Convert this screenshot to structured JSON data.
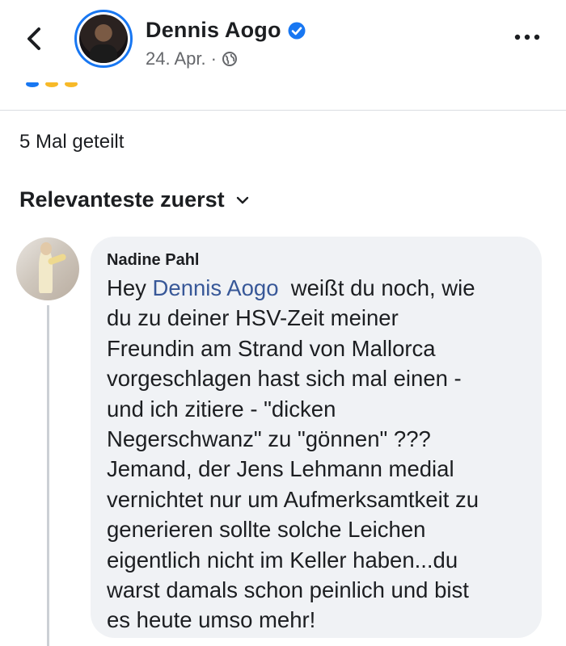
{
  "header": {
    "author_name": "Dennis Aogo",
    "date": "24. Apr.",
    "separator": "·",
    "icons": {
      "back": "chevron-left-icon",
      "verified": "verified-badge-icon",
      "audience": "globe-icon",
      "more": "more-dots-icon"
    },
    "colors": {
      "verified": "#1877f2",
      "avatar_ring": "#1877f2"
    }
  },
  "post_stats": {
    "shares": "5 Mal geteilt"
  },
  "comments_sort": {
    "label": "Relevanteste zuerst",
    "icon": "chevron-down-icon"
  },
  "comment": {
    "author": "Nadine Pahl",
    "prefix": "Hey ",
    "mention": "Dennis Aogo",
    "body": "  weißt du noch, wie\ndu zu deiner HSV-Zeit meiner\nFreundin am Strand von Mallorca\nvorgeschlagen hast sich mal einen -\nund ich zitiere - \"dicken\nNegerschwanz\" zu \"gönnen\" ???\nJemand, der Jens Lehmann medial\nvernichtet nur um Aufmerksamtkeit zu\ngenerieren sollte solche Leichen\neigentlich nicht im Keller haben...du\nwarst damals schon peinlich und bist\nes heute umso mehr!",
    "colors": {
      "mention": "#385898",
      "bubble": "#f0f2f5"
    }
  }
}
